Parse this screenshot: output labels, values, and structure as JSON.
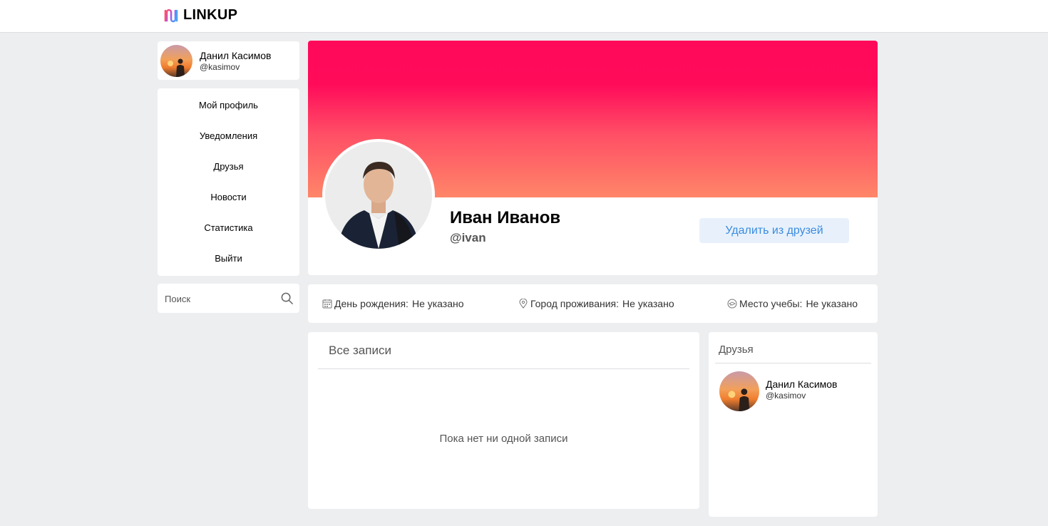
{
  "app": {
    "name": "LINKUP"
  },
  "current_user": {
    "name": "Данил Касимов",
    "handle": "@kasimov"
  },
  "nav": {
    "items": [
      {
        "label": "Мой профиль"
      },
      {
        "label": "Уведомления"
      },
      {
        "label": "Друзья"
      },
      {
        "label": "Новости"
      },
      {
        "label": "Статистика"
      },
      {
        "label": "Выйти"
      }
    ]
  },
  "search": {
    "placeholder": "Поиск"
  },
  "profile": {
    "name": "Иван Иванов",
    "handle": "@ivan",
    "action_label": "Удалить из друзей",
    "cover_colors": [
      "#ff0a5a",
      "#ff8668"
    ]
  },
  "info": {
    "birthday": {
      "label": "День рождения:",
      "value": "Не указано"
    },
    "city": {
      "label": "Город проживания:",
      "value": "Не указано"
    },
    "study": {
      "label": "Место учебы:",
      "value": "Не указано"
    }
  },
  "posts": {
    "title": "Все записи",
    "empty_text": "Пока нет ни одной записи"
  },
  "friends": {
    "title": "Друзья",
    "items": [
      {
        "name": "Данил Касимов",
        "handle": "@kasimov"
      }
    ]
  },
  "colors": {
    "accent": "#3a8be0",
    "button_bg": "#e8f1fb",
    "page_bg": "#edeef0"
  }
}
